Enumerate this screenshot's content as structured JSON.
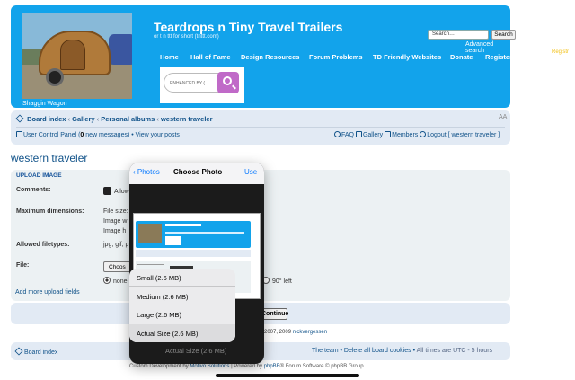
{
  "header": {
    "site_title": "Teardrops n Tiny Travel Trailers",
    "site_subtitle": "or t n ttt for short (tnttt.com)",
    "logo_caption": "Shaggin Wagon",
    "nav": [
      {
        "label": "Home"
      },
      {
        "label": "Hall of Fame"
      },
      {
        "label": "Design Resources"
      },
      {
        "label": "Forum Problems"
      },
      {
        "label": "TD Friendly Websites"
      },
      {
        "label": "Donate"
      },
      {
        "label": "Register"
      }
    ],
    "ad_placeholder": "ENHANCED BY (",
    "search_placeholder": "Search…",
    "search_button": "Search",
    "advanced_search": "Advanced search",
    "right_peek": "Registr"
  },
  "breadcrumb": {
    "items": [
      "Board index",
      "Gallery",
      "Personal albums",
      "western traveler"
    ],
    "separator": "‹",
    "font_size_icon": "font-size-icon"
  },
  "userbar": {
    "ucp_prefix": "User Control Panel (",
    "new_messages_count": "0",
    "ucp_suffix": " new messages) • View your posts",
    "faq": "FAQ",
    "gallery": "Gallery",
    "members": "Members",
    "logout": "Logout [ western traveler ]"
  },
  "page": {
    "title": "western traveler",
    "upload_heading": "UPLOAD IMAGE",
    "comments_label": "Comments:",
    "comments_value": "Allow",
    "max_dim_label": "Maximum dimensions:",
    "max_dim_lines": [
      "File size:",
      "Image w",
      "Image h"
    ],
    "filetypes_label": "Allowed filetypes:",
    "filetypes_value": "jpg, gif, p",
    "file_label": "File:",
    "choose_button": "Choos",
    "rotate_none": "none",
    "rotate_left": "90° left",
    "add_fields": "Add more upload fields",
    "continue_button": "Continue",
    "copyright": "2007, 2009",
    "copyright_author": "nickvergessen"
  },
  "footer": {
    "board_index": "Board index",
    "team": "The team",
    "delete_cookies": "Delete all board cookies",
    "timezone": "All times are UTC - 5 hours",
    "dev_prefix": "Custom Development by ",
    "dev_link": "Motivo Solutions",
    "powered_prefix": " | Powered by ",
    "powered_link": "phpBB",
    "powered_suffix": "® Forum Software © phpBB Group"
  },
  "picker": {
    "back_label": "Photos",
    "title": "Choose Photo",
    "use_label": "Use",
    "preview_title": "Teardrops n Tiny Travel Trailers",
    "sizes": [
      "Small (2.6 MB)",
      "Medium (2.6 MB)",
      "Large (2.6 MB)",
      "Actual Size (2.6 MB)"
    ],
    "ghost_label": "Actual Size (2.6 MB)"
  },
  "colors": {
    "header_blue": "#12a3eb",
    "link_blue": "#105289",
    "ios_blue": "#0a7aff"
  }
}
